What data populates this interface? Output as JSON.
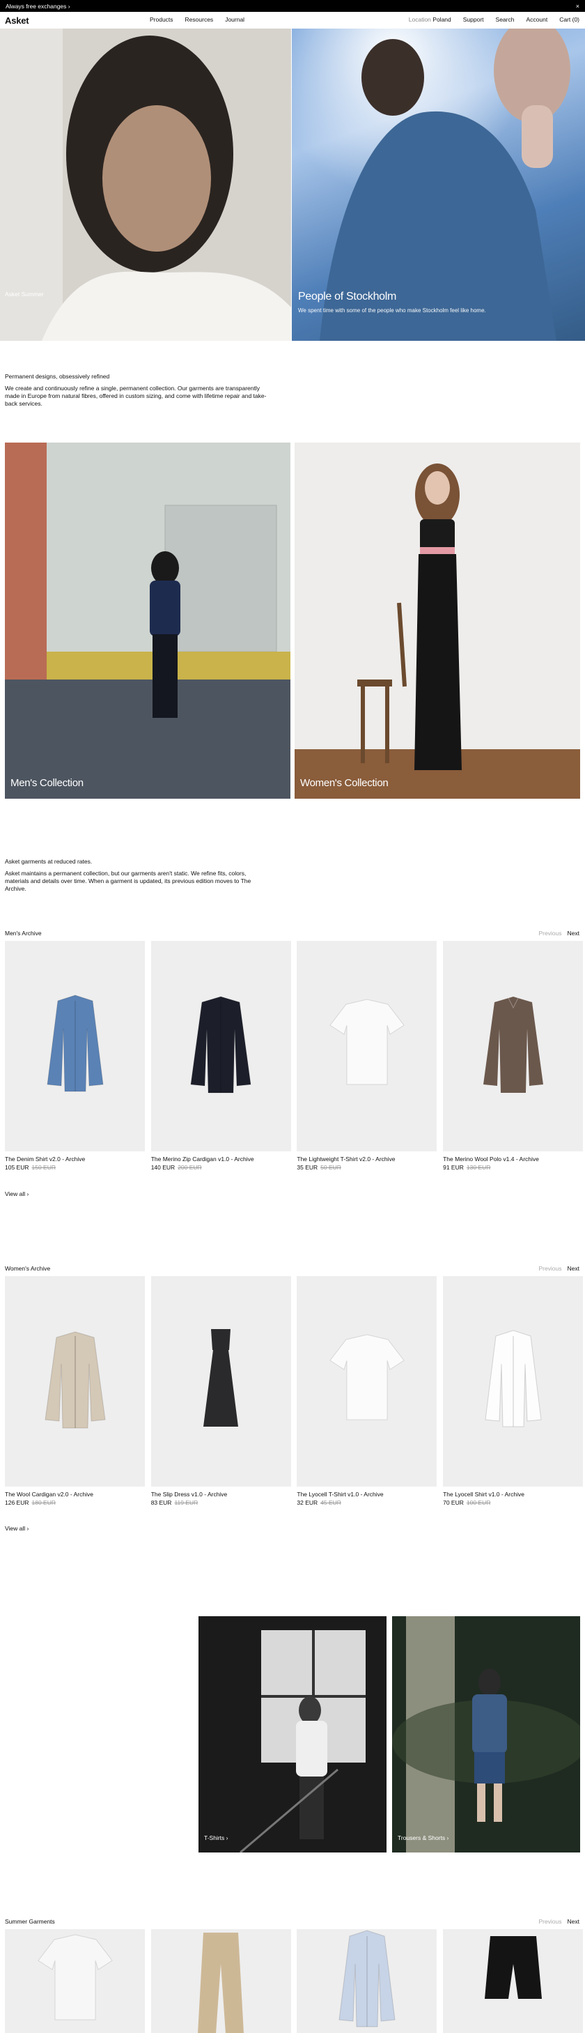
{
  "announcement": {
    "text": "Always free exchanges",
    "arrow": "›",
    "close": "×"
  },
  "header": {
    "logo": "Asket",
    "nav": [
      "Products",
      "Resources",
      "Journal"
    ],
    "location_key": "Location",
    "location_value": "Poland",
    "support": "Support",
    "search": "Search",
    "account": "Account",
    "cart": "Cart (0)"
  },
  "hero": {
    "left_caption": "Asket Summer",
    "right_title": "People of Stockholm",
    "right_sub": "We spent time with some of the people who make Stockholm feel like home."
  },
  "intro": {
    "title": "Permanent designs, obsessively refined",
    "body": "We create and continuously refine a single, permanent collection. Our garments are transparently made in Europe from natural fibres, offered in custom sizing, and come with lifetime repair and take-back services."
  },
  "collections": {
    "men": "Men's Collection",
    "women": "Women's Collection"
  },
  "archive_intro": {
    "title": "Asket garments at reduced rates.",
    "body": "Asket maintains a permanent collection, but our garments aren't static. We refine fits, colors, materials and details over time. When a garment is updated, its previous edition moves to The Archive."
  },
  "pager": {
    "prev": "Previous",
    "next": "Next"
  },
  "mens_archive": {
    "title": "Men's Archive",
    "view_all": "View all ›",
    "products": [
      {
        "name": "The Denim Shirt v2.0 - Archive",
        "price": "105 EUR",
        "old": "150 EUR",
        "color": "#5a82b5",
        "icon": "shirt-icon"
      },
      {
        "name": "The Merino Zip Cardigan v1.0 - Archive",
        "price": "140 EUR",
        "old": "200 EUR",
        "color": "#1c1f2a",
        "icon": "cardigan-icon"
      },
      {
        "name": "The Lightweight T-Shirt v2.0 - Archive",
        "price": "35 EUR",
        "old": "50 EUR",
        "color": "#fafafa",
        "icon": "tshirt-icon"
      },
      {
        "name": "The Merino Wool Polo v1.4 - Archive",
        "price": "91 EUR",
        "old": "130 EUR",
        "color": "#6b584c",
        "icon": "polo-icon"
      }
    ]
  },
  "womens_archive": {
    "title": "Women's Archive",
    "view_all": "View all ›",
    "products": [
      {
        "name": "The Wool Cardigan v2.0 - Archive",
        "price": "126 EUR",
        "old": "180 EUR",
        "color": "#d4c8b6",
        "icon": "cardigan-icon"
      },
      {
        "name": "The Slip Dress v1.0 - Archive",
        "price": "83 EUR",
        "old": "119 EUR",
        "color": "#2a2a2c",
        "icon": "dress-icon"
      },
      {
        "name": "The Lyocell T-Shirt v1.0 - Archive",
        "price": "32 EUR",
        "old": "45 EUR",
        "color": "#fbfbfb",
        "icon": "tshirt-icon"
      },
      {
        "name": "The Lyocell Shirt v1.0 - Archive",
        "price": "70 EUR",
        "old": "100 EUR",
        "color": "#fdfdfd",
        "icon": "shirt-icon"
      }
    ]
  },
  "promos": {
    "tshirts": "T-Shirts ›",
    "trousers": "Trousers & Shorts ›"
  },
  "summer": {
    "title": "Summer Garments",
    "products": [
      {
        "color": "#f7f7f7",
        "icon": "tshirt-icon"
      },
      {
        "color": "#cdb896",
        "icon": "trousers-icon"
      },
      {
        "color": "#c7d3e6",
        "icon": "shirt-icon"
      },
      {
        "color": "#141414",
        "icon": "shorts-icon"
      }
    ]
  }
}
